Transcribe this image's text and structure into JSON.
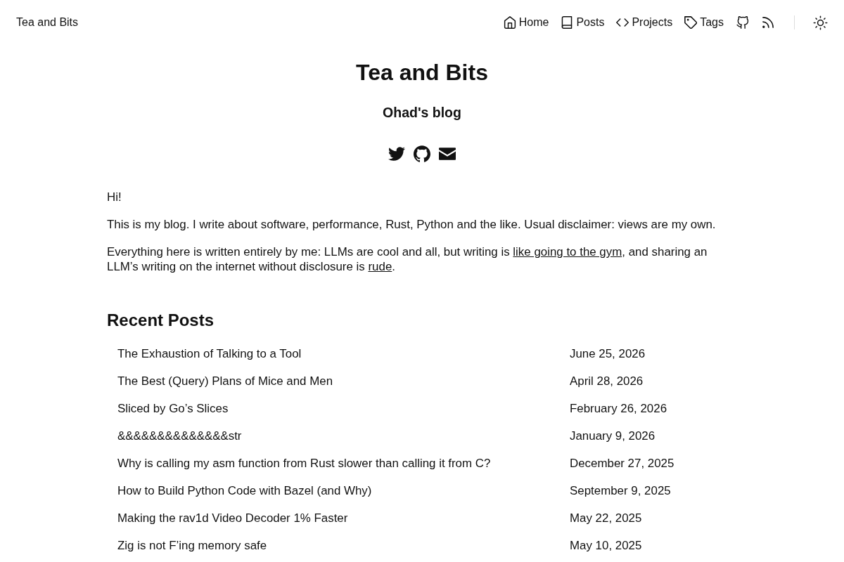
{
  "header": {
    "brand": "Tea and Bits",
    "nav": [
      {
        "label": "Home"
      },
      {
        "label": "Posts"
      },
      {
        "label": "Projects"
      },
      {
        "label": "Tags"
      }
    ]
  },
  "hero": {
    "title": "Tea and Bits",
    "subtitle": "Ohad's blog"
  },
  "intro": [
    [
      {
        "text": "Hi!",
        "kind": "text"
      }
    ],
    [
      {
        "text": "This is my blog. I write about software, performance, Rust, Python and the like. Usual disclaimer: views are my own.",
        "kind": "text"
      }
    ],
    [
      {
        "text": "Everything here is written entirely by me: LLMs are cool and all, but writing is ",
        "kind": "text"
      },
      {
        "text": "like going to the gym",
        "kind": "link"
      },
      {
        "text": ", and sharing an LLM’s writing on the internet without disclosure is ",
        "kind": "text"
      },
      {
        "text": "rude",
        "kind": "link"
      },
      {
        "text": ".",
        "kind": "text"
      }
    ]
  ],
  "recent_posts": {
    "heading": "Recent Posts",
    "posts": [
      {
        "title": "The Exhaustion of Talking to a Tool",
        "date": "June 25, 2026"
      },
      {
        "title": "The Best (Query) Plans of Mice and Men",
        "date": "April 28, 2026"
      },
      {
        "title": "Sliced by Go’s Slices",
        "date": "February 26, 2026"
      },
      {
        "title": "&&&&&&&&&&&&&&str",
        "date": "January 9, 2026"
      },
      {
        "title": "Why is calling my asm function from Rust slower than calling it from C?",
        "date": "December 27, 2025"
      },
      {
        "title": "How to Build Python Code with Bazel (and Why)",
        "date": "September 9, 2025"
      },
      {
        "title": "Making the rav1d Video Decoder 1% Faster",
        "date": "May 22, 2025"
      },
      {
        "title": "Zig is not F’ing memory safe",
        "date": "May 10, 2025"
      }
    ]
  }
}
